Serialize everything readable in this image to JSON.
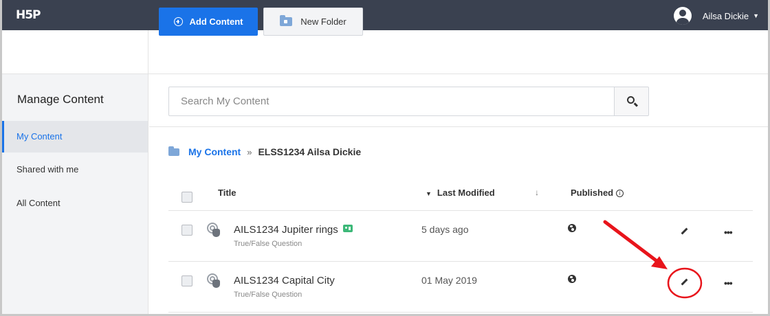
{
  "app": {
    "logo": "H5P"
  },
  "header": {
    "user_name": "Ailsa Dickie",
    "caret": "▼"
  },
  "toolbar": {
    "add_content_label": "Add Content",
    "new_folder_label": "New Folder"
  },
  "sidebar": {
    "title": "Manage Content",
    "items": [
      {
        "label": "My Content",
        "active": true
      },
      {
        "label": "Shared with me",
        "active": false
      },
      {
        "label": "All Content",
        "active": false
      }
    ]
  },
  "search": {
    "placeholder": "Search My Content",
    "value": ""
  },
  "breadcrumb": {
    "link": "My Content",
    "separator": "»",
    "current": "ELSS1234 Ailsa Dickie"
  },
  "table": {
    "headers": {
      "title": "Title",
      "last_modified": "Last Modified",
      "published": "Published",
      "sort_caret": "▼",
      "sort_arrow": "↓",
      "info": "i"
    },
    "rows": [
      {
        "title": "AILS1234 Jupiter rings",
        "type": "True/False Question",
        "modified": "5 days ago",
        "shared": true
      },
      {
        "title": "AILS1234 Capital City",
        "type": "True/False Question",
        "modified": "01 May 2019",
        "shared": false
      }
    ],
    "row_actions_label": "•••"
  },
  "colors": {
    "topbar": "#3a4150",
    "accent": "#1a73e8",
    "annotation": "#e8141b"
  }
}
